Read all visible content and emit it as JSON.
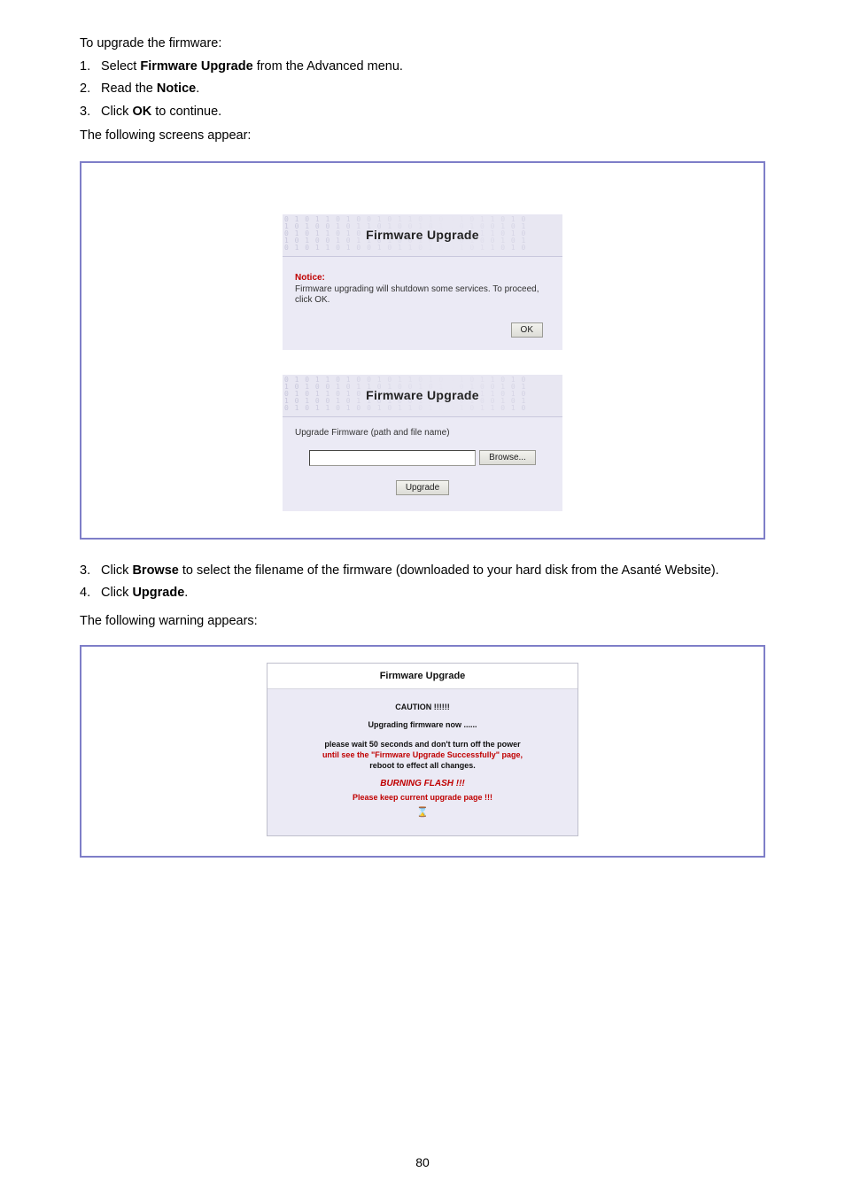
{
  "intro_sentence": "To upgrade the firmware:",
  "steps_top": [
    {
      "n": "1.",
      "t_before": "Select ",
      "bold": "Firmware Upgrade",
      "t_after": " from the Advanced menu."
    },
    {
      "n": "2.",
      "t_before": "Read the ",
      "bold": "Notice",
      "t_after": "."
    },
    {
      "n": "3.",
      "t_before": "Click ",
      "bold": "OK",
      "t_after": " to continue."
    }
  ],
  "panel_intro": "The following screens appear:",
  "panel1": {
    "title": "Firmware Upgrade",
    "notice_label": "Notice:",
    "notice_text": "Firmware upgrading will shutdown some services. To proceed, click OK.",
    "ok_label": "OK"
  },
  "panel2": {
    "title": "Firmware Upgrade",
    "field_label": "Upgrade Firmware (path and file name)",
    "browse_label": "Browse...",
    "upgrade_label": "Upgrade"
  },
  "steps_mid": [
    {
      "n": "3.",
      "t_before": "Click ",
      "bold": "Browse",
      "t_after": " to select the filename of the firmware (downloaded to your hard disk from the Asanté Website)."
    },
    {
      "n": "4.",
      "t_before": "Click ",
      "bold": "Upgrade",
      "t_after": "."
    }
  ],
  "warning_line": "The following warning appears:",
  "caution": {
    "title": "Firmware Upgrade",
    "caution": "CAUTION !!!!!!",
    "upgrading": "Upgrading firmware now ......",
    "line1": "please wait 50 seconds and don't turn off the power",
    "line2_red": "until see the \"Firmware Upgrade Successfully\" page,",
    "line3": "reboot to effect all changes.",
    "burning": "BURNING FLASH !!!",
    "keep": "Please keep current upgrade page !!!"
  },
  "page_number": "80"
}
